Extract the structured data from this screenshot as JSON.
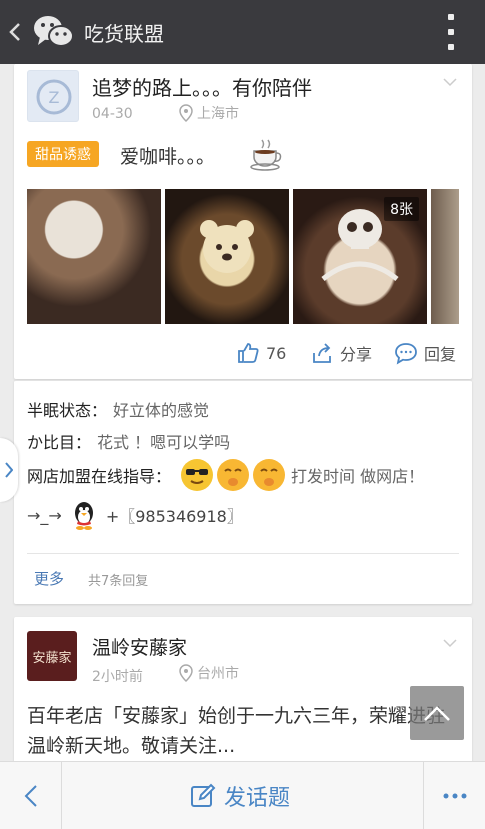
{
  "header": {
    "title": "吃货联盟"
  },
  "post1": {
    "author": "追梦的路上。。。有你陪伴",
    "date": "04-30",
    "location": "上海市",
    "tag": "甜品诱惑",
    "text": "爱咖啡。。。",
    "photo_count": "8张",
    "likes": "76",
    "share_label": "分享",
    "reply_label": "回复"
  },
  "replies": {
    "items": [
      {
        "user": "半眠状态：",
        "text": "好立体的感觉"
      },
      {
        "user": "か比目：",
        "text": "花式 ！嗯可以学吗"
      },
      {
        "user": "网店加盟在线指导：",
        "text": "打发时间 做网店！"
      }
    ],
    "contact_prefix": "→_→",
    "contact_text": "+〖985346918〗",
    "more_label": "更多",
    "total": "共7条回复"
  },
  "post2": {
    "author": "温岭安藤家",
    "logo_text": "安藤家",
    "date": "2小时前",
    "location": "台州市",
    "body": "百年老店「安藤家」始创于一九六三年，荣耀进驻温岭新天地。敬请关注..."
  },
  "bottom": {
    "compose_label": "发话题"
  },
  "colors": {
    "topbar": "#3a3a3e",
    "tag": "#f6a623",
    "link": "#4a79b4",
    "accent": "#4a86c5"
  }
}
